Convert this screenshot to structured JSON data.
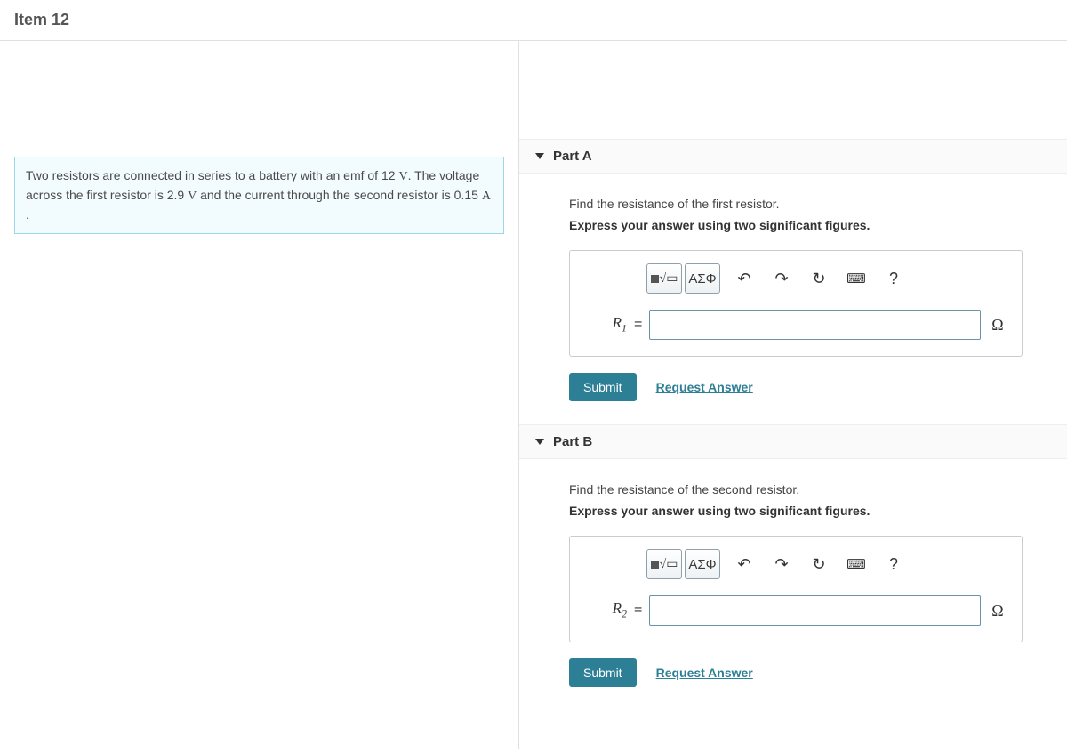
{
  "header": {
    "title": "Item 12"
  },
  "problem": {
    "text_prefix": "Two resistors are connected in series to a battery with an emf of 12 ",
    "unit1": "V",
    "text_mid1": ". The voltage across the first resistor is 2.9 ",
    "unit2": "V",
    "text_mid2": " and the current through the second resistor is 0.15 ",
    "unit3": "A",
    "text_suffix": " ."
  },
  "parts": {
    "a": {
      "title": "Part A",
      "prompt": "Find the resistance of the first resistor.",
      "hint": "Express your answer using two significant figures.",
      "var_html": "R",
      "var_sub": "1",
      "eq": "=",
      "unit": "Ω",
      "value": "",
      "submit": "Submit",
      "request": "Request Answer",
      "greek_btn": "ΑΣΦ"
    },
    "b": {
      "title": "Part B",
      "prompt": "Find the resistance of the second resistor.",
      "hint": "Express your answer using two significant figures.",
      "var_html": "R",
      "var_sub": "2",
      "eq": "=",
      "unit": "Ω",
      "value": "",
      "submit": "Submit",
      "request": "Request Answer",
      "greek_btn": "ΑΣΦ"
    }
  },
  "toolbar_icons": {
    "undo": "↶",
    "redo": "↷",
    "reset": "↻",
    "keyboard": "⌨",
    "help": "?"
  }
}
